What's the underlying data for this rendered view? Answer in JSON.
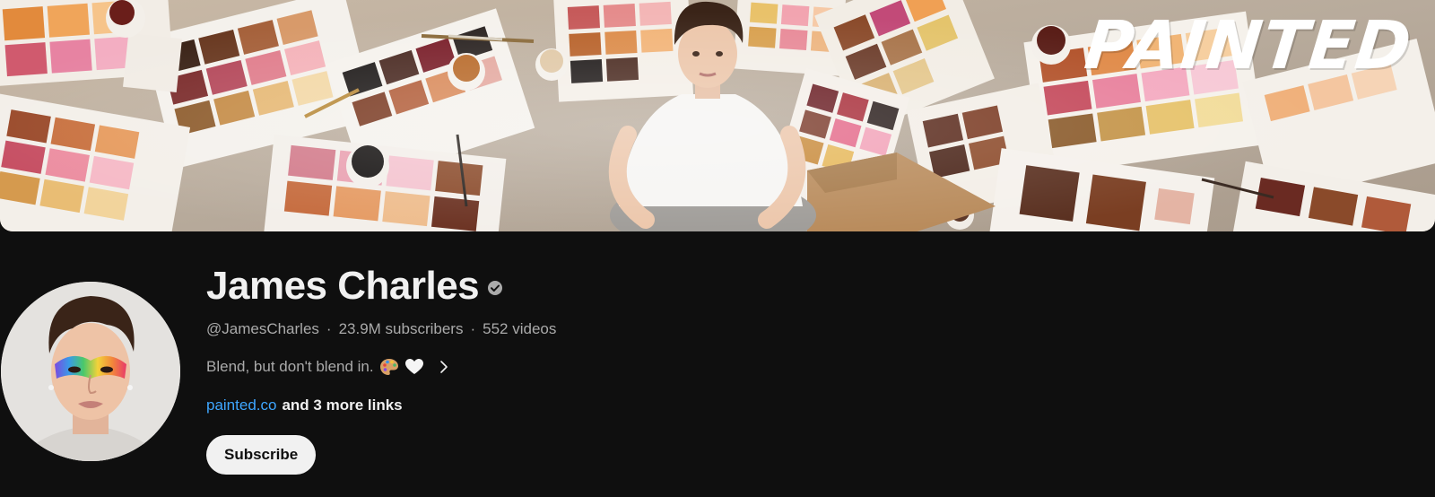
{
  "banner": {
    "brand_text": "PAINTED"
  },
  "channel": {
    "name": "James Charles",
    "verified_icon": "verified-check-icon",
    "handle": "@JamesCharles",
    "subscribers": "23.9M subscribers",
    "videos": "552 videos",
    "separator": "·",
    "description": "Blend, but don't blend in.",
    "description_emojis": [
      "artist-palette-emoji",
      "white-heart-emoji"
    ],
    "more_icon": "chevron-right-icon",
    "link_primary": "painted.co",
    "link_more": "and 3 more links",
    "subscribe_label": "Subscribe"
  },
  "colors": {
    "background": "#0f0f0f",
    "text_primary": "#f1f1f1",
    "text_secondary": "#aaaaaa",
    "link": "#3ea6ff",
    "button_bg": "#f1f1f1",
    "button_text": "#0f0f0f"
  }
}
